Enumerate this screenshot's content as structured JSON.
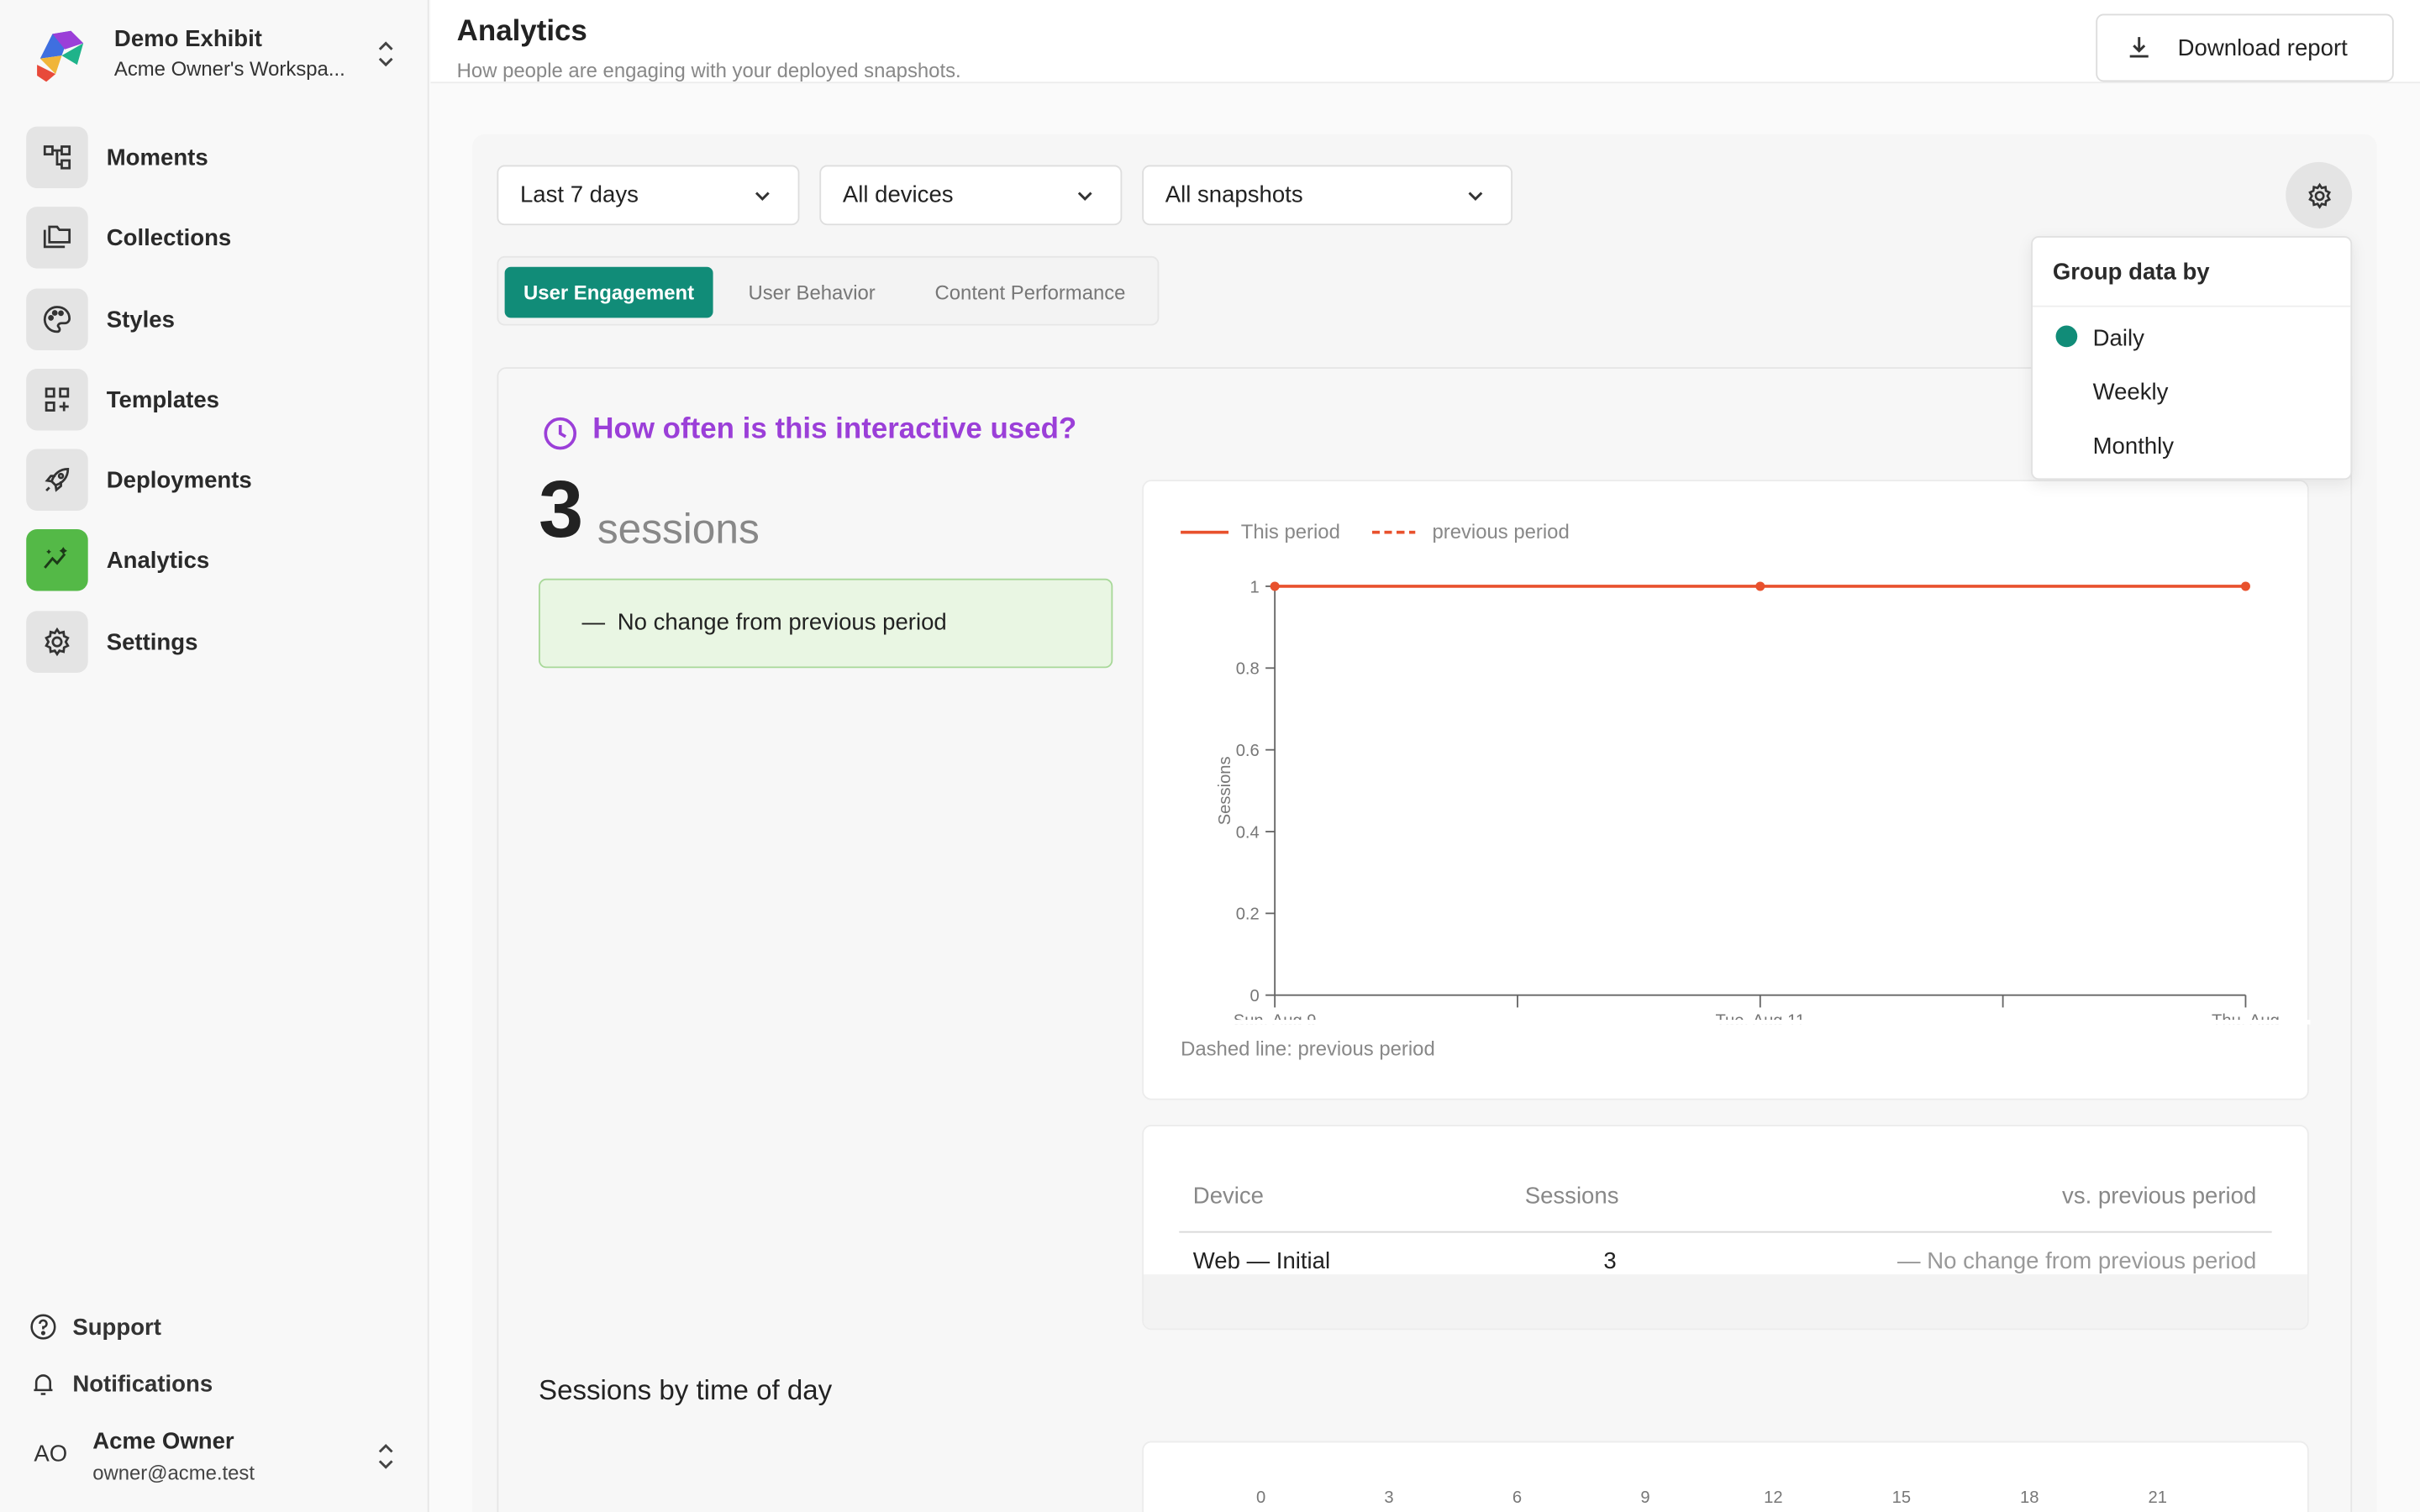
{
  "workspace": {
    "name": "Demo Exhibit",
    "subtitle": "Acme Owner's Workspa..."
  },
  "nav": [
    {
      "label": "Moments",
      "icon": "moments-icon"
    },
    {
      "label": "Collections",
      "icon": "collections-icon"
    },
    {
      "label": "Styles",
      "icon": "palette-icon"
    },
    {
      "label": "Templates",
      "icon": "templates-icon"
    },
    {
      "label": "Deployments",
      "icon": "rocket-icon"
    },
    {
      "label": "Analytics",
      "icon": "analytics-icon",
      "active": true
    },
    {
      "label": "Settings",
      "icon": "gear-icon"
    }
  ],
  "footer": {
    "support": "Support",
    "notifications": "Notifications"
  },
  "user": {
    "initials": "AO",
    "name": "Acme Owner",
    "email": "owner@acme.test"
  },
  "header": {
    "title": "Analytics",
    "subtitle": "How people are engaging with your deployed snapshots.",
    "download_label": "Download report"
  },
  "filters": {
    "period": "Last 7 days",
    "devices": "All devices",
    "snapshots": "All snapshots"
  },
  "tabs": [
    "User Engagement",
    "User Behavior",
    "Content Performance"
  ],
  "active_tab": "User Engagement",
  "popover": {
    "title": "Group data by",
    "options": [
      "Daily",
      "Weekly",
      "Monthly"
    ],
    "selected": "Daily"
  },
  "engagement": {
    "question": "How often is this interactive used?",
    "count": "3",
    "unit": "sessions",
    "change_dash": "—",
    "change_text": "No change from previous period"
  },
  "chart_note": "Dashed line: previous period",
  "table": {
    "headers": {
      "device": "Device",
      "sessions": "Sessions",
      "vs": "vs. previous period"
    },
    "rows": [
      {
        "device": "Web — Initial",
        "sessions": "3",
        "vs": "— No change from previous period"
      }
    ]
  },
  "time_of_day": {
    "title": "Sessions by time of day",
    "hours": [
      "0",
      "3",
      "6",
      "9",
      "12",
      "15",
      "18",
      "21"
    ]
  },
  "colors": {
    "accent": "#118c78",
    "question": "#9b3fd8",
    "line": "#e8512d",
    "active_nav": "#54b947"
  },
  "chart_data": {
    "type": "line",
    "legend": [
      "This period",
      "previous period"
    ],
    "ylabel": "Sessions",
    "xlabel": "",
    "x": [
      "Sun, Aug 9",
      "Tue, Aug 11",
      "Thu, Aug"
    ],
    "x_tick_count": 5,
    "yticks": [
      "0",
      "0.2",
      "0.4",
      "0.6",
      "0.8",
      "1"
    ],
    "ylim": [
      0,
      1
    ],
    "series": [
      {
        "name": "This period",
        "values": [
          1,
          1,
          1
        ]
      }
    ],
    "grid": false,
    "legend_position": "top-left"
  }
}
